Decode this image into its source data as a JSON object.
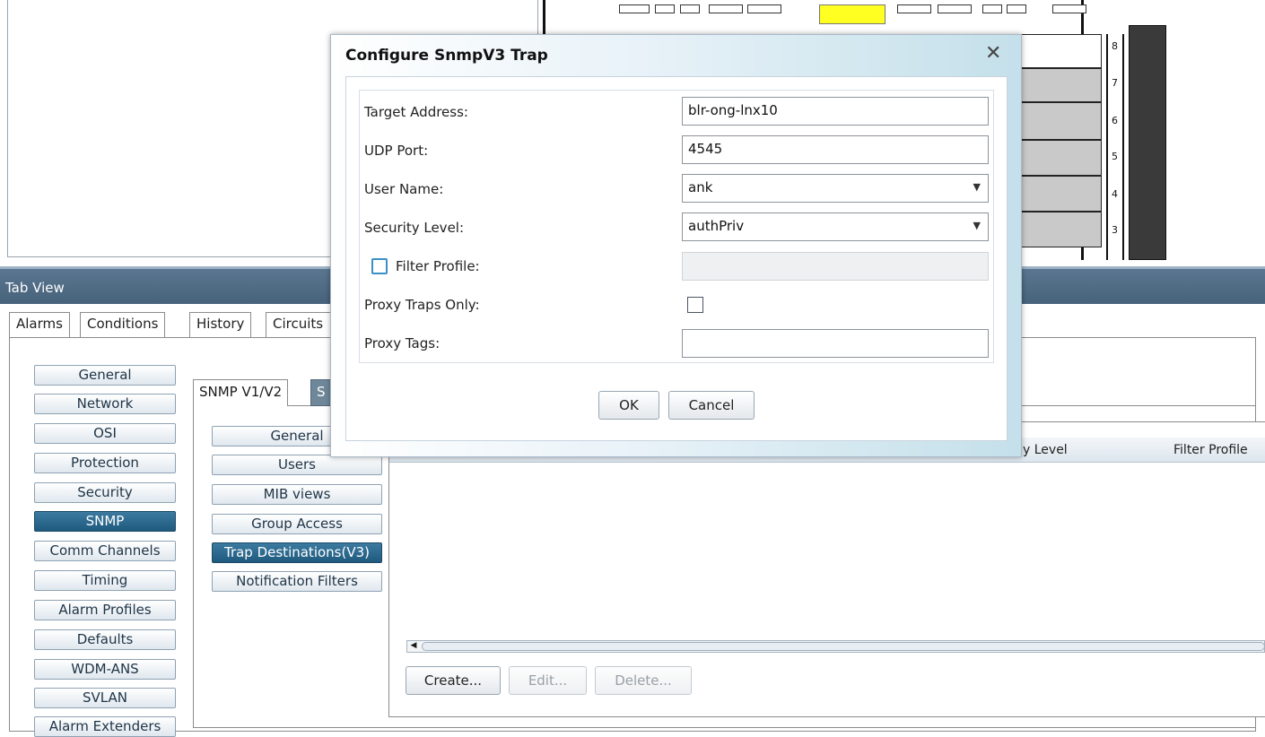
{
  "shelf": {
    "slot_numbers": [
      "8",
      "7",
      "6",
      "5",
      "4",
      "3"
    ]
  },
  "tab_view": {
    "title": "Tab View",
    "tabs": [
      "Alarms",
      "Conditions",
      "History",
      "Circuits"
    ]
  },
  "categories": [
    "General",
    "Network",
    "OSI",
    "Protection",
    "Security",
    "SNMP",
    "Comm Channels",
    "Timing",
    "Alarm Profiles",
    "Defaults",
    "WDM-ANS",
    "SVLAN",
    "Alarm Extenders"
  ],
  "active_category": "SNMP",
  "snmp_tabs": {
    "v1v2": "SNMP V1/V2",
    "v3": "S"
  },
  "snmp_subitems": [
    "General",
    "Users",
    "MIB views",
    "Group Access",
    "Trap Destinations(V3)",
    "Notification Filters"
  ],
  "active_subitem": "Trap Destinations(V3)",
  "table": {
    "columns": [
      "y Level",
      "Filter Profile"
    ]
  },
  "table_buttons": {
    "create": "Create...",
    "edit": "Edit...",
    "delete": "Delete..."
  },
  "dialog": {
    "title": "Configure SnmpV3 Trap",
    "close": "✕",
    "fields": {
      "target_address": {
        "label": "Target Address:",
        "value": "blr-ong-lnx10"
      },
      "udp_port": {
        "label": "UDP Port:",
        "value": "4545"
      },
      "user_name": {
        "label": "User Name:",
        "value": "ank"
      },
      "security_level": {
        "label": "Security Level:",
        "value": "authPriv"
      },
      "filter_profile": {
        "label": "Filter Profile:",
        "value": "",
        "checked": false
      },
      "proxy_traps_only": {
        "label": "Proxy Traps Only:",
        "checked": false
      },
      "proxy_tags": {
        "label": "Proxy Tags:",
        "value": ""
      }
    },
    "ok": "OK",
    "cancel": "Cancel"
  },
  "colors": {
    "tabview_bar": "#4f6b85",
    "active_button": "#1f5a7e",
    "highlight_card": "#ffff22"
  }
}
